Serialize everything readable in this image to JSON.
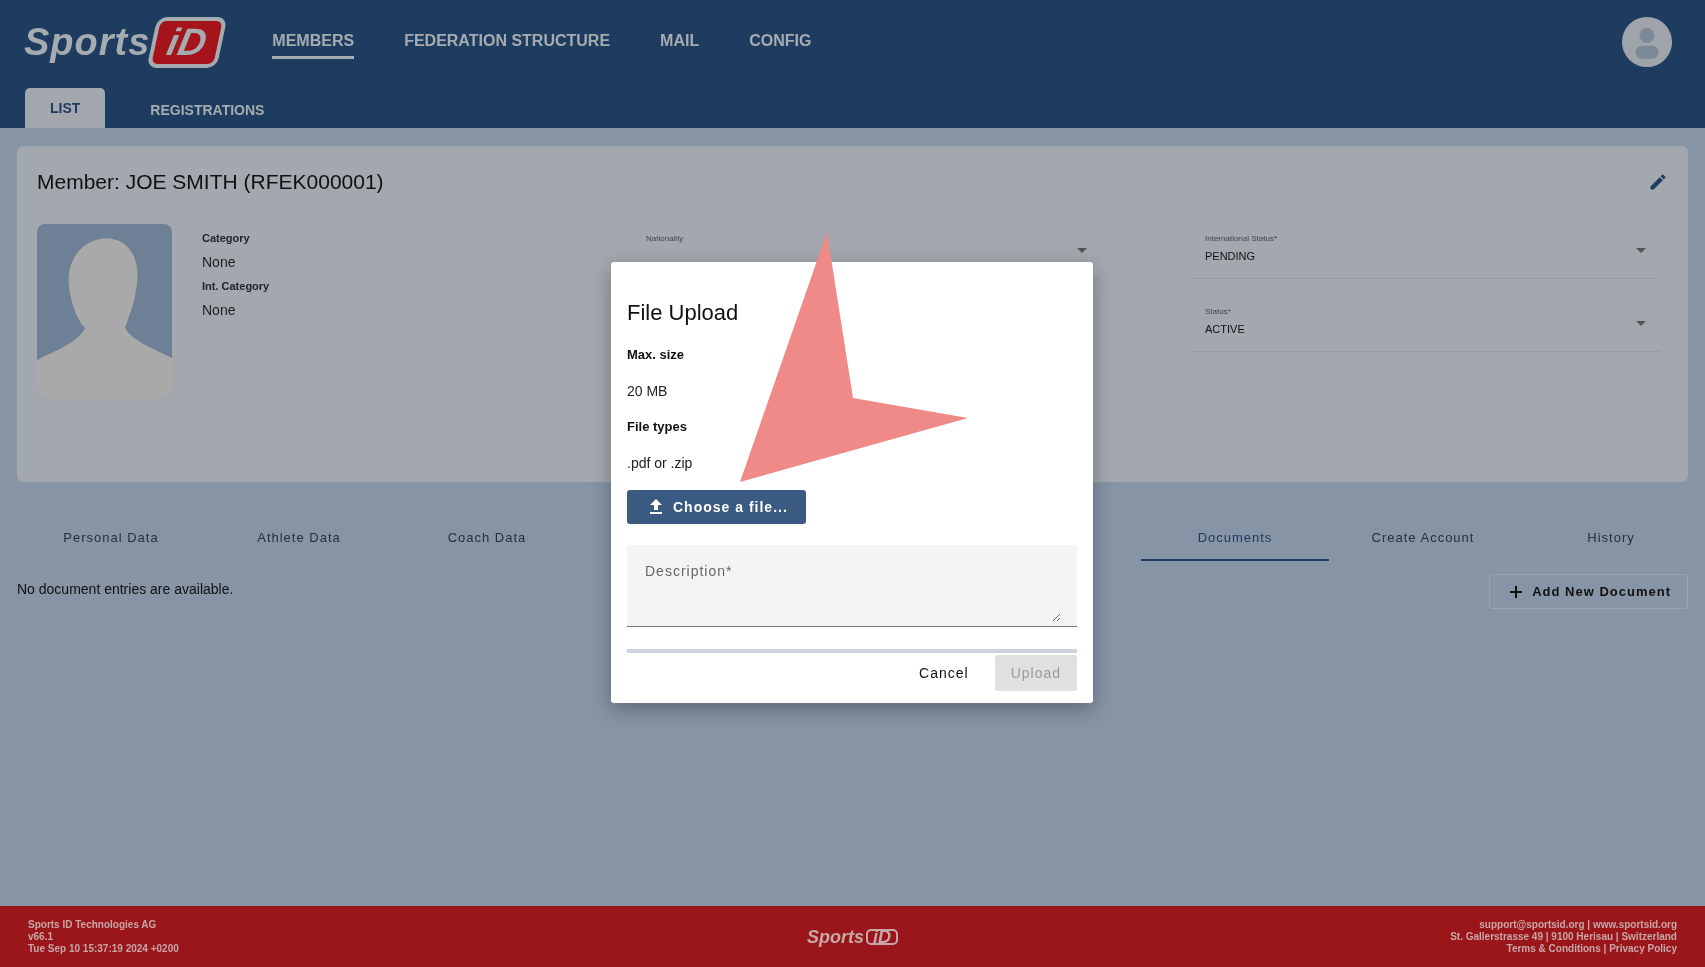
{
  "header": {
    "logo": {
      "word": "Sports",
      "mark": "iD"
    },
    "nav": [
      {
        "label": "MEMBERS",
        "selected": true
      },
      {
        "label": "FEDERATION STRUCTURE",
        "selected": false
      },
      {
        "label": "MAIL",
        "selected": false
      },
      {
        "label": "CONFIG",
        "selected": false
      }
    ],
    "subtabs": [
      {
        "label": "LIST",
        "selected": true
      },
      {
        "label": "REGISTRATIONS",
        "selected": false
      }
    ]
  },
  "member": {
    "title": "Member: JOE SMITH (RFEK000001)",
    "info": [
      {
        "label": "Category",
        "value": "None"
      },
      {
        "label": "Int. Category",
        "value": "None"
      }
    ],
    "fields": [
      {
        "label": "Nationality"
      },
      {
        "label": "International Status*",
        "value": "PENDING"
      },
      {
        "label": "Status*",
        "value": "ACTIVE"
      }
    ]
  },
  "tabs": [
    {
      "label": "Personal Data",
      "selected": false
    },
    {
      "label": "Athlete Data",
      "selected": false
    },
    {
      "label": "Coach Data",
      "selected": false
    },
    {
      "label": "Documents",
      "selected": true
    },
    {
      "label": "Create Account",
      "selected": false
    },
    {
      "label": "History",
      "selected": false
    }
  ],
  "empty_message": "No document entries are available.",
  "add_button": "Add New Document",
  "dialog": {
    "title": "File Upload",
    "sections": [
      {
        "label": "Max. size",
        "value": "20 MB"
      },
      {
        "label": "File types",
        "value": ".pdf or .zip"
      }
    ],
    "choose_button": "Choose a file...",
    "description": {
      "placeholder": "Description*"
    },
    "buttons": [
      {
        "label": "Cancel",
        "disabled": false
      },
      {
        "label": "Upload",
        "disabled": true
      }
    ]
  },
  "footer": {
    "left": [
      "Sports ID Technologies AG",
      "v66.1",
      "Tue Sep 10 15:37:19 2024 +0200"
    ],
    "logo": {
      "word": "Sports",
      "mark": "iD"
    },
    "right": [
      "support@sportsid.org | www.sportsid.org",
      "St. Gallerstrasse 49 | 9100 Herisau | Switzerland",
      "Terms & Conditions | Privacy Policy"
    ]
  }
}
